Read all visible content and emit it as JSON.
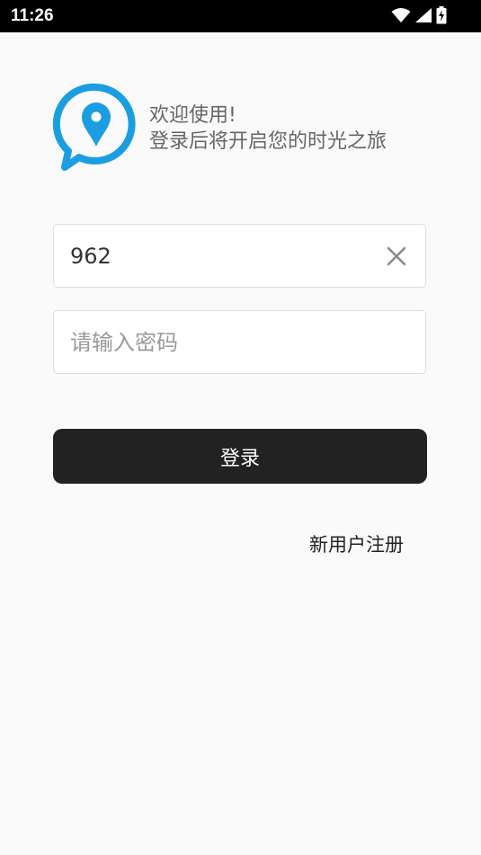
{
  "status_bar": {
    "time": "11:26",
    "icons": [
      "wifi-icon",
      "signal-icon",
      "battery-charging-icon"
    ]
  },
  "brand": {
    "logo_icon": "location-chat-bubble-icon",
    "accent_color": "#1a9ee0"
  },
  "welcome": {
    "line1": "欢迎使用!",
    "line2": "登录后将开启您的时光之旅"
  },
  "username_field": {
    "value": "962",
    "clear_icon": "close-icon"
  },
  "password_field": {
    "value": "",
    "placeholder": "请输入密码"
  },
  "login_button": {
    "label": "登录"
  },
  "register_link": {
    "label": "新用户注册"
  }
}
